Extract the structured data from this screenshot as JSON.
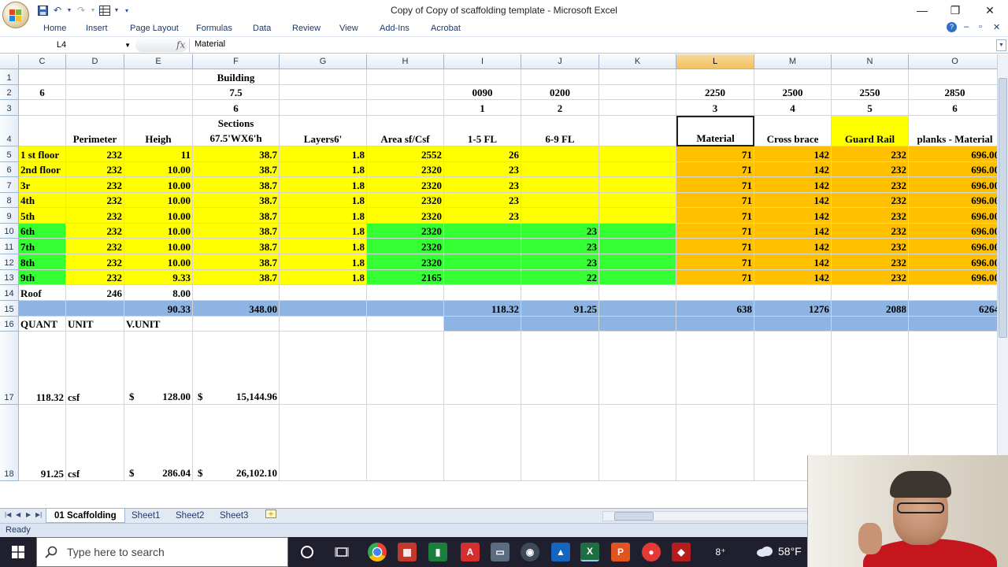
{
  "window": {
    "title": "Copy of Copy of scaffolding template - Microsoft Excel",
    "controls": {
      "minimize": "—",
      "restore": "❐",
      "close": "✕"
    }
  },
  "ribbon_tabs": [
    "Home",
    "Insert",
    "Page Layout",
    "Formulas",
    "Data",
    "Review",
    "View",
    "Add-Ins",
    "Acrobat"
  ],
  "formula_bar": {
    "name_box": "L4",
    "fx": "fx",
    "content": "Material"
  },
  "columns": [
    "C",
    "D",
    "E",
    "F",
    "G",
    "H",
    "I",
    "J",
    "K",
    "L",
    "M",
    "N",
    "O"
  ],
  "selected_column": "L",
  "rows": [
    {
      "num": "1",
      "cells": {
        "F": "Building"
      }
    },
    {
      "num": "2",
      "cells": {
        "C": "6",
        "F": "7.5",
        "I": "0090",
        "J": "0200",
        "L": "2250",
        "M": "2500",
        "N": "2550",
        "O": "2850"
      }
    },
    {
      "num": "3",
      "cells": {
        "F": "6",
        "I": "1",
        "J": "2",
        "L": "3",
        "M": "4",
        "N": "5",
        "O": "6"
      }
    },
    {
      "num": "4",
      "cells": {
        "D": "Perimeter",
        "E": "Heigh",
        "F_line1": "Sections",
        "F_line2": "67.5'WX6'h",
        "G": "Layers6'",
        "H": "Area sf/Csf",
        "I": "1-5 FL",
        "J": "6-9 FL",
        "L": "Material",
        "M": "Cross brace",
        "N": "Guard Rail",
        "O": "planks - Material"
      }
    },
    {
      "num": "5",
      "cells": {
        "C": "1 st floor",
        "D": "232",
        "E": "11",
        "F": "38.7",
        "G": "1.8",
        "H": "2552",
        "I": "26",
        "L": "71",
        "M": "142",
        "N": "232",
        "O": "696.00"
      }
    },
    {
      "num": "6",
      "cells": {
        "C": "2nd floor",
        "D": "232",
        "E": "10.00",
        "F": "38.7",
        "G": "1.8",
        "H": "2320",
        "I": "23",
        "L": "71",
        "M": "142",
        "N": "232",
        "O": "696.00"
      }
    },
    {
      "num": "7",
      "cells": {
        "C": "3r",
        "D": "232",
        "E": "10.00",
        "F": "38.7",
        "G": "1.8",
        "H": "2320",
        "I": "23",
        "L": "71",
        "M": "142",
        "N": "232",
        "O": "696.00"
      }
    },
    {
      "num": "8",
      "cells": {
        "C": "4th",
        "D": "232",
        "E": "10.00",
        "F": "38.7",
        "G": "1.8",
        "H": "2320",
        "I": "23",
        "L": "71",
        "M": "142",
        "N": "232",
        "O": "696.00"
      }
    },
    {
      "num": "9",
      "cells": {
        "C": "5th",
        "D": "232",
        "E": "10.00",
        "F": "38.7",
        "G": "1.8",
        "H": "2320",
        "I": "23",
        "L": "71",
        "M": "142",
        "N": "232",
        "O": "696.00"
      }
    },
    {
      "num": "10",
      "cells": {
        "C": "6th",
        "D": "232",
        "E": "10.00",
        "F": "38.7",
        "G": "1.8",
        "H": "2320",
        "J": "23",
        "L": "71",
        "M": "142",
        "N": "232",
        "O": "696.00"
      }
    },
    {
      "num": "11",
      "cells": {
        "C": "7th",
        "D": "232",
        "E": "10.00",
        "F": "38.7",
        "G": "1.8",
        "H": "2320",
        "J": "23",
        "L": "71",
        "M": "142",
        "N": "232",
        "O": "696.00"
      }
    },
    {
      "num": "12",
      "cells": {
        "C": "8th",
        "D": "232",
        "E": "10.00",
        "F": "38.7",
        "G": "1.8",
        "H": "2320",
        "J": "23",
        "L": "71",
        "M": "142",
        "N": "232",
        "O": "696.00"
      }
    },
    {
      "num": "13",
      "cells": {
        "C": "9th",
        "D": "232",
        "E": "9.33",
        "F": "38.7",
        "G": "1.8",
        "H": "2165",
        "J": "22",
        "L": "71",
        "M": "142",
        "N": "232",
        "O": "696.00"
      }
    },
    {
      "num": "14",
      "cells": {
        "C": "Roof",
        "D": "246",
        "E": "8.00"
      }
    },
    {
      "num": "15",
      "cells": {
        "E": "90.33",
        "F": "348.00",
        "I": "118.32",
        "J": "91.25",
        "L": "638",
        "M": "1276",
        "N": "2088",
        "O": "6264"
      }
    },
    {
      "num": "16",
      "cells": {
        "C": "QUANT",
        "D": "UNIT",
        "E": "V.UNIT"
      }
    },
    {
      "num": "17",
      "cells": {
        "C": "118.32",
        "D": "csf",
        "E_sym": "$",
        "E": "128.00",
        "F_sym": "$",
        "F": "15,144.96"
      }
    },
    {
      "num": "18",
      "cells": {
        "C": "91.25",
        "D": "csf",
        "E_sym": "$",
        "E": "286.04",
        "F_sym": "$",
        "F": "26,102.10"
      }
    }
  ],
  "sheet_tabs": [
    "01 Scaffolding",
    "Sheet1",
    "Sheet2",
    "Sheet3"
  ],
  "active_sheet": "01 Scaffolding",
  "status": "Ready",
  "taskbar": {
    "search_placeholder": "Type here to search",
    "weather": "58°F"
  },
  "colors": {
    "yellow": "#ffff00",
    "green": "#33ff33",
    "orange": "#ffc000",
    "blue": "#8db4e2"
  }
}
